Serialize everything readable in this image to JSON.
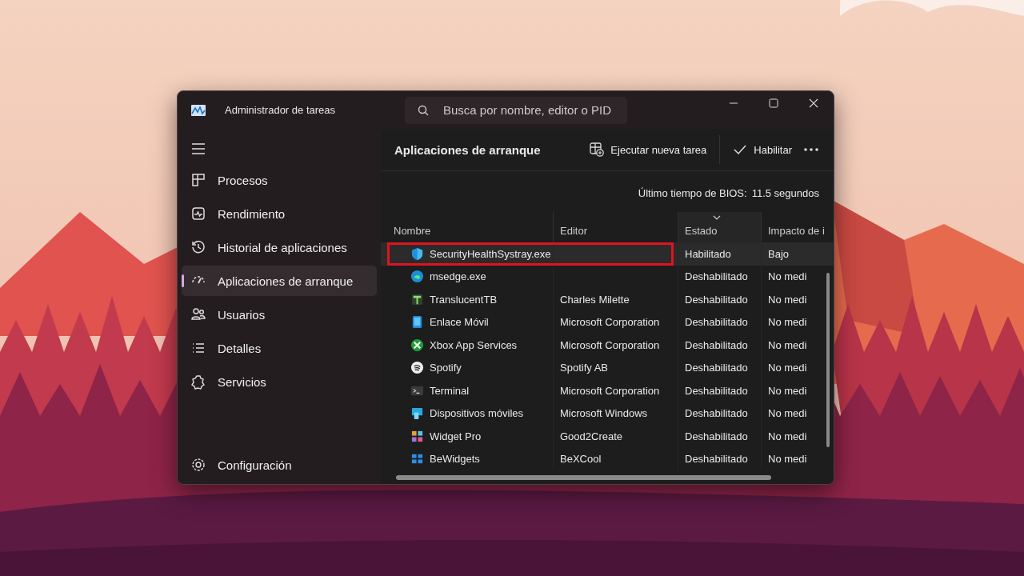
{
  "window": {
    "title": "Administrador de tareas",
    "search": {
      "placeholder": "Busca por nombre, editor o PID"
    }
  },
  "sidebar": {
    "items": [
      {
        "label": "Procesos",
        "selected": false
      },
      {
        "label": "Rendimiento",
        "selected": false
      },
      {
        "label": "Historial de aplicaciones",
        "selected": false
      },
      {
        "label": "Aplicaciones de arranque",
        "selected": true
      },
      {
        "label": "Usuarios",
        "selected": false
      },
      {
        "label": "Detalles",
        "selected": false
      },
      {
        "label": "Servicios",
        "selected": false
      }
    ],
    "footer": {
      "label": "Configuración"
    }
  },
  "page": {
    "title": "Aplicaciones de arranque",
    "actions": [
      {
        "label": "Ejecutar nueva tarea",
        "kind": "run"
      },
      {
        "label": "Habilitar",
        "kind": "enable"
      }
    ],
    "bios": {
      "label": "Último tiempo de BIOS:",
      "value": "11.5 segundos"
    }
  },
  "table": {
    "columns": [
      {
        "label": "Nombre",
        "sorted": false
      },
      {
        "label": "Editor",
        "sorted": false
      },
      {
        "label": "Estado",
        "sorted": true
      },
      {
        "label": "Impacto de i",
        "sorted": false
      }
    ],
    "rows": [
      {
        "name": "SecurityHealthSystray.exe",
        "publisher": "",
        "status": "Habilitado",
        "impact": "Bajo",
        "selected": true,
        "outlined": true
      },
      {
        "name": "msedge.exe",
        "publisher": "",
        "status": "Deshabilitado",
        "impact": "No medi",
        "selected": false,
        "outlined": false
      },
      {
        "name": "TranslucentTB",
        "publisher": "Charles Milette",
        "status": "Deshabilitado",
        "impact": "No medi",
        "selected": false,
        "outlined": false
      },
      {
        "name": "Enlace Móvil",
        "publisher": "Microsoft Corporation",
        "status": "Deshabilitado",
        "impact": "No medi",
        "selected": false,
        "outlined": false
      },
      {
        "name": "Xbox App Services",
        "publisher": "Microsoft Corporation",
        "status": "Deshabilitado",
        "impact": "No medi",
        "selected": false,
        "outlined": false
      },
      {
        "name": "Spotify",
        "publisher": "Spotify AB",
        "status": "Deshabilitado",
        "impact": "No medi",
        "selected": false,
        "outlined": false
      },
      {
        "name": "Terminal",
        "publisher": "Microsoft Corporation",
        "status": "Deshabilitado",
        "impact": "No medi",
        "selected": false,
        "outlined": false
      },
      {
        "name": "Dispositivos móviles",
        "publisher": "Microsoft Windows",
        "status": "Deshabilitado",
        "impact": "No medi",
        "selected": false,
        "outlined": false
      },
      {
        "name": "Widget Pro",
        "publisher": "Good2Create",
        "status": "Deshabilitado",
        "impact": "No medi",
        "selected": false,
        "outlined": false
      },
      {
        "name": "BeWidgets",
        "publisher": "BeXCool",
        "status": "Deshabilitado",
        "impact": "No medi",
        "selected": false,
        "outlined": false
      }
    ]
  }
}
